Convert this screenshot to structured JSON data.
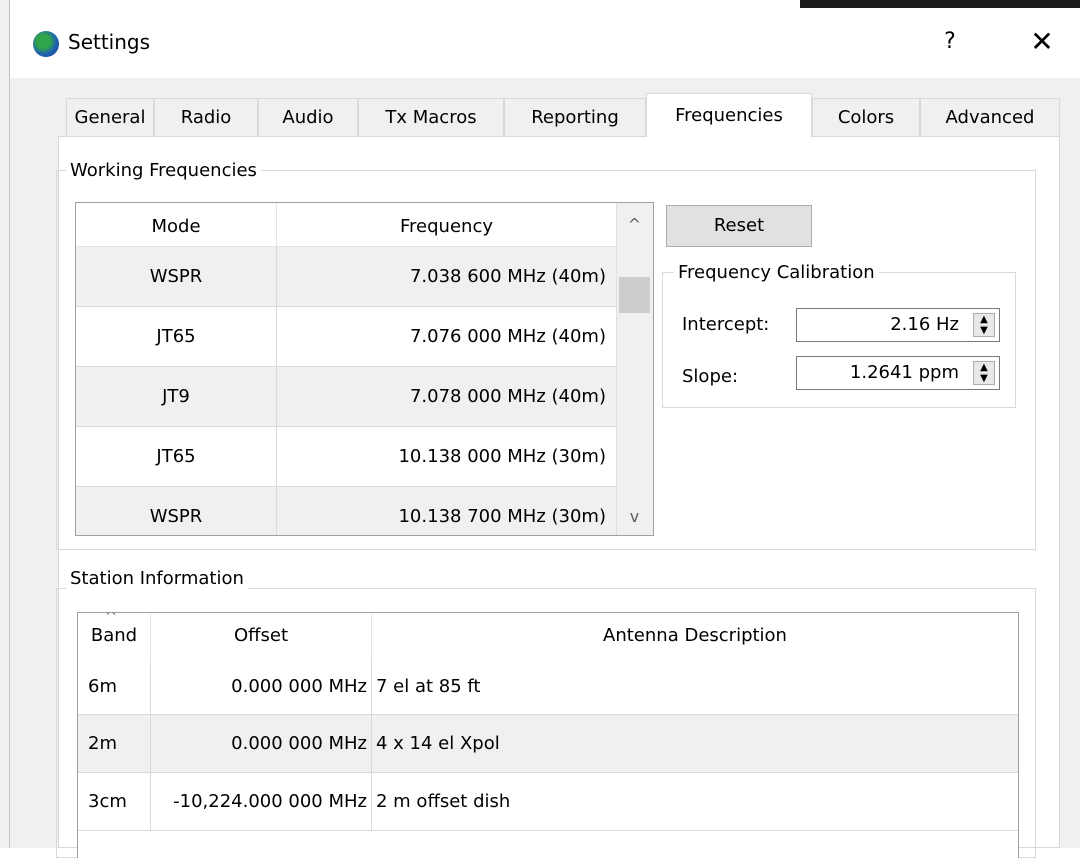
{
  "window": {
    "title": "Settings",
    "help_glyph": "?",
    "close_glyph": "✕"
  },
  "tabs": [
    {
      "label": "General"
    },
    {
      "label": "Radio"
    },
    {
      "label": "Audio"
    },
    {
      "label": "Tx Macros"
    },
    {
      "label": "Reporting"
    },
    {
      "label": "Frequencies",
      "active": true
    },
    {
      "label": "Colors"
    },
    {
      "label": "Advanced"
    }
  ],
  "working_frequencies": {
    "group_title": "Working Frequencies",
    "columns": [
      "Mode",
      "Frequency"
    ],
    "rows": [
      {
        "mode": "WSPR",
        "frequency": "7.038 600 MHz (40m)"
      },
      {
        "mode": "JT65",
        "frequency": "7.076 000 MHz (40m)"
      },
      {
        "mode": "JT9",
        "frequency": "7.078 000 MHz (40m)"
      },
      {
        "mode": "JT65",
        "frequency": "10.138 000 MHz (30m)"
      },
      {
        "mode": "WSPR",
        "frequency": "10.138 700 MHz (30m)"
      }
    ],
    "sort_glyph": "^",
    "scroll_up_glyph": "^",
    "scroll_down_glyph": "v"
  },
  "reset_button": {
    "label": "Reset"
  },
  "calibration": {
    "group_title": "Frequency Calibration",
    "intercept_label": "Intercept:",
    "intercept_value": "2.16 Hz",
    "slope_label": "Slope:",
    "slope_value": "1.2641 ppm"
  },
  "station_information": {
    "group_title": "Station Information",
    "columns": [
      "Band",
      "Offset",
      "Antenna Description"
    ],
    "rows": [
      {
        "band": "6m",
        "offset": "0.000 000 MHz",
        "antenna": "7 el at 85 ft"
      },
      {
        "band": "2m",
        "offset": "0.000 000 MHz",
        "antenna": "4 x 14 el Xpol"
      },
      {
        "band": "3cm",
        "offset": "-10,224.000 000 MHz",
        "antenna": "2 m offset dish"
      }
    ],
    "sort_glyph": "^"
  },
  "colors": {
    "alt_row": "#f0f0f0",
    "grid_line": "#d9d9d9",
    "accent_icon": "#1e5fb3"
  }
}
